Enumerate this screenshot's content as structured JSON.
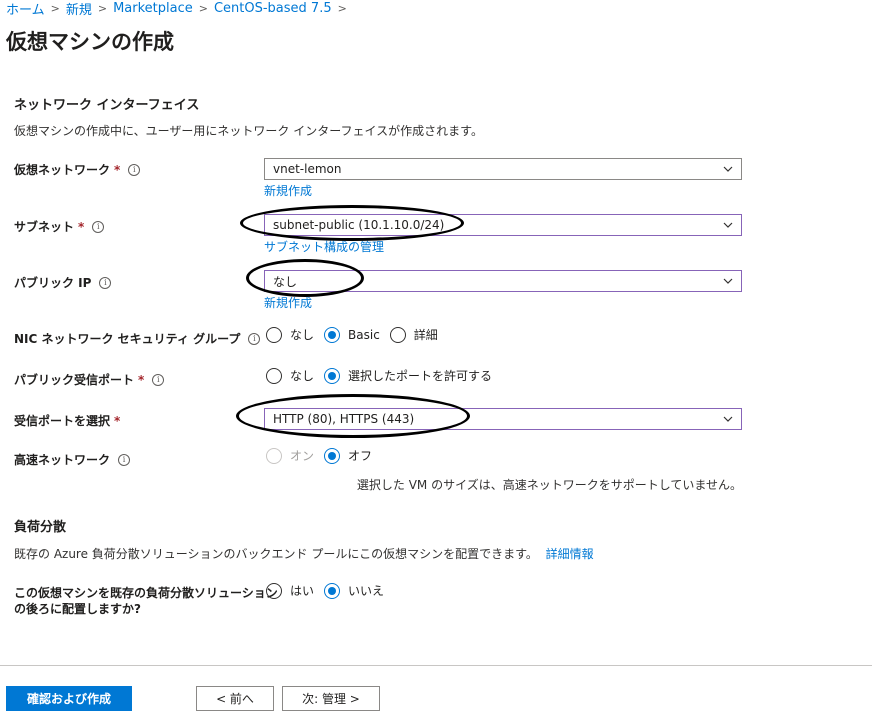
{
  "breadcrumb": [
    "ホーム",
    "新規",
    "Marketplace",
    "CentOS-based 7.5"
  ],
  "page_title": "仮想マシンの作成",
  "network": {
    "heading": "ネットワーク インターフェイス",
    "description": "仮想マシンの作成中に、ユーザー用にネットワーク インターフェイスが作成されます。",
    "vnet": {
      "label": "仮想ネットワーク",
      "value": "vnet-lemon",
      "link": "新規作成"
    },
    "subnet": {
      "label": "サブネット",
      "value": "subnet-public (10.1.10.0/24)",
      "link": "サブネット構成の管理"
    },
    "public_ip": {
      "label": "パブリック IP",
      "value": "なし",
      "link": "新規作成"
    },
    "nic_nsg": {
      "label": "NIC ネットワーク セキュリティ グループ",
      "options": [
        "なし",
        "Basic",
        "詳細"
      ],
      "selected": "Basic"
    },
    "public_ports": {
      "label": "パブリック受信ポート",
      "options": [
        "なし",
        "選択したポートを許可する"
      ],
      "selected": "選択したポートを許可する"
    },
    "inbound_ports": {
      "label": "受信ポートを選択",
      "value": "HTTP (80), HTTPS (443)"
    },
    "accel": {
      "label": "高速ネットワーク",
      "options": [
        "オン",
        "オフ"
      ],
      "selected": "オフ",
      "note": "選択した VM のサイズは、高速ネットワークをサポートしていません。"
    }
  },
  "lb": {
    "heading": "負荷分散",
    "description": "既存の Azure 負荷分散ソリューションのバックエンド プールにこの仮想マシンを配置できます。",
    "learn_more": "詳細情報",
    "question_line1": "この仮想マシンを既存の負荷分散ソリューション",
    "question_line2": "の後ろに配置しますか?",
    "options": [
      "はい",
      "いいえ"
    ],
    "selected": "いいえ"
  },
  "required_mark": "*",
  "info_glyph": "i",
  "buttons": {
    "review": "確認および作成",
    "prev": "< 前へ",
    "next": "次: 管理 >"
  },
  "colors": {
    "accent": "#0078d4",
    "required": "#a4262c",
    "focus_border": "#8764b8"
  },
  "icons": {
    "breadcrumb_sep": "chevron-right-icon",
    "select": "chevron-down-icon",
    "info": "info-icon"
  }
}
